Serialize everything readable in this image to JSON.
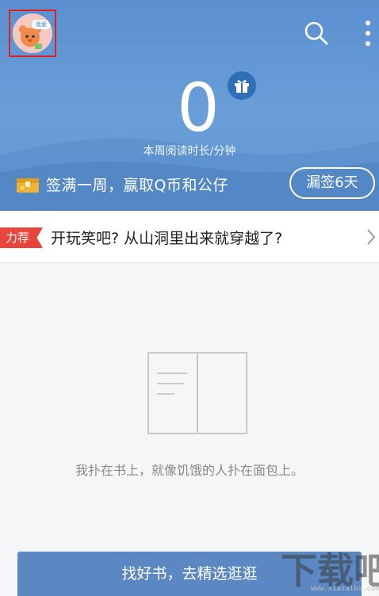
{
  "header": {
    "avatar_badge": "我爱",
    "weekly_minutes": "0",
    "weekly_label": "本周阅读时长/分钟",
    "signin_text": "签满一周，赢取Q币和公仔",
    "missed_button": "漏签6天"
  },
  "recommend": {
    "tag": "力荐",
    "title": "开玩笑吧? 从山洞里出来就穿越了?"
  },
  "empty": {
    "message": "我扑在书上，就像饥饿的人扑在面包上。"
  },
  "footer": {
    "find_button": "找好书，去精选逛逛"
  },
  "watermark": {
    "logo_text": "下载吧",
    "url": "www.xiazaiba.com"
  },
  "colors": {
    "header_blue": "#5b8fd0",
    "recommend_red": "#e8453c",
    "button_blue": "#5b88c2"
  }
}
